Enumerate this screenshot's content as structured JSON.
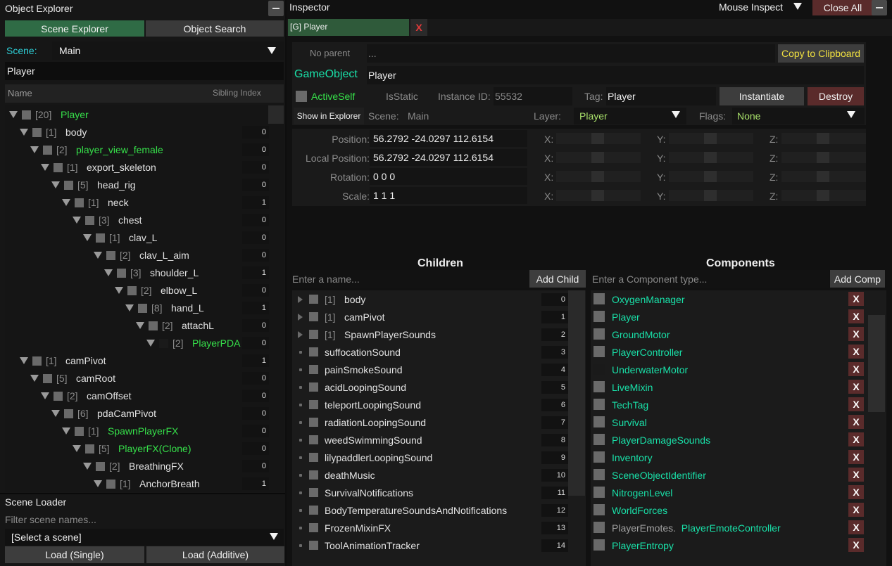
{
  "object_explorer": {
    "title": "Object Explorer",
    "tabs": [
      "Scene Explorer",
      "Object Search"
    ],
    "scene_label": "Scene:",
    "scene_value": "Main",
    "filter_value": "Player",
    "col_name": "Name",
    "col_sibling": "Sibling Index",
    "tree": [
      {
        "depth": 0,
        "count": "[20]",
        "name": "Player",
        "green": true,
        "idx": ""
      },
      {
        "depth": 1,
        "count": "[1]",
        "name": "body",
        "green": false,
        "idx": "0"
      },
      {
        "depth": 2,
        "count": "[2]",
        "name": "player_view_female",
        "green": true,
        "idx": "0"
      },
      {
        "depth": 3,
        "count": "[1]",
        "name": "export_skeleton",
        "green": false,
        "idx": "0"
      },
      {
        "depth": 4,
        "count": "[5]",
        "name": "head_rig",
        "green": false,
        "idx": "0"
      },
      {
        "depth": 5,
        "count": "[1]",
        "name": "neck",
        "green": false,
        "idx": "1"
      },
      {
        "depth": 6,
        "count": "[3]",
        "name": "chest",
        "green": false,
        "idx": "0"
      },
      {
        "depth": 7,
        "count": "[1]",
        "name": "clav_L",
        "green": false,
        "idx": "0"
      },
      {
        "depth": 8,
        "count": "[2]",
        "name": "clav_L_aim",
        "green": false,
        "idx": "0"
      },
      {
        "depth": 9,
        "count": "[3]",
        "name": "shoulder_L",
        "green": false,
        "idx": "1"
      },
      {
        "depth": 10,
        "count": "[2]",
        "name": "elbow_L",
        "green": false,
        "idx": "0"
      },
      {
        "depth": 11,
        "count": "[8]",
        "name": "hand_L",
        "green": false,
        "idx": "1"
      },
      {
        "depth": 12,
        "count": "[2]",
        "name": "attachL",
        "green": false,
        "idx": "0"
      },
      {
        "depth": 13,
        "count": "[2]",
        "name": "PlayerPDA",
        "green": true,
        "idx": "0",
        "off": true
      },
      {
        "depth": 1,
        "count": "[1]",
        "name": "camPivot",
        "green": false,
        "idx": "1"
      },
      {
        "depth": 2,
        "count": "[5]",
        "name": "camRoot",
        "green": false,
        "idx": "0"
      },
      {
        "depth": 3,
        "count": "[2]",
        "name": "camOffset",
        "green": false,
        "idx": "0"
      },
      {
        "depth": 4,
        "count": "[6]",
        "name": "pdaCamPivot",
        "green": false,
        "idx": "0"
      },
      {
        "depth": 5,
        "count": "[1]",
        "name": "SpawnPlayerFX",
        "green": true,
        "idx": "0"
      },
      {
        "depth": 6,
        "count": "[5]",
        "name": "PlayerFX(Clone)",
        "green": true,
        "idx": "0"
      },
      {
        "depth": 7,
        "count": "[2]",
        "name": "BreathingFX",
        "green": false,
        "idx": "0"
      },
      {
        "depth": 8,
        "count": "[1]",
        "name": "AnchorBreath",
        "green": false,
        "idx": "1"
      }
    ]
  },
  "scene_loader": {
    "title": "Scene Loader",
    "filter_placeholder": "Filter scene names...",
    "select_value": "[Select a scene]",
    "load_single": "Load (Single)",
    "load_additive": "Load (Additive)"
  },
  "inspector": {
    "title": "Inspector",
    "mouse_inspect": "Mouse Inspect",
    "close_all": "Close All",
    "tab_label": "[G] Player",
    "tab_close": "X",
    "no_parent": "No parent",
    "parent_value": "...",
    "copy_clipboard": "Copy to Clipboard",
    "gameobject_label": "GameObject",
    "name_value": "Player",
    "active_self": "ActiveSelf",
    "is_static": "IsStatic",
    "instance_id_label": "Instance ID:",
    "instance_id_value": "55532",
    "tag_label": "Tag:",
    "tag_value": "Player",
    "instantiate": "Instantiate",
    "destroy": "Destroy",
    "show_in_explorer": "Show in Explorer",
    "scene_label": "Scene:",
    "scene_value": "Main",
    "layer_label": "Layer:",
    "layer_value": "Player",
    "flags_label": "Flags:",
    "flags_value": "None",
    "transforms": [
      {
        "label": "Position:",
        "value": "56.2792 -24.0297 112.6154"
      },
      {
        "label": "Local Position:",
        "value": "56.2792 -24.0297 112.6154"
      },
      {
        "label": "Rotation:",
        "value": "0 0 0"
      },
      {
        "label": "Scale:",
        "value": "1 1 1"
      }
    ],
    "axis_labels": [
      "X:",
      "Y:",
      "Z:"
    ],
    "children_title": "Children",
    "children_placeholder": "Enter a name...",
    "add_child": "Add Child",
    "children": [
      {
        "name": "body",
        "count": "[1]",
        "idx": "0",
        "expand": true
      },
      {
        "name": "camPivot",
        "count": "[1]",
        "idx": "1",
        "expand": true
      },
      {
        "name": "SpawnPlayerSounds",
        "count": "[1]",
        "idx": "2",
        "expand": true
      },
      {
        "name": "suffocationSound",
        "count": "",
        "idx": "3",
        "expand": false
      },
      {
        "name": "painSmokeSound",
        "count": "",
        "idx": "4",
        "expand": false
      },
      {
        "name": "acidLoopingSound",
        "count": "",
        "idx": "5",
        "expand": false
      },
      {
        "name": "teleportLoopingSound",
        "count": "",
        "idx": "6",
        "expand": false
      },
      {
        "name": "radiationLoopingSound",
        "count": "",
        "idx": "7",
        "expand": false
      },
      {
        "name": "weedSwimmingSound",
        "count": "",
        "idx": "8",
        "expand": false
      },
      {
        "name": "lilypaddlerLoopingSound",
        "count": "",
        "idx": "9",
        "expand": false
      },
      {
        "name": "deathMusic",
        "count": "",
        "idx": "10",
        "expand": false
      },
      {
        "name": "SurvivalNotifications",
        "count": "",
        "idx": "11",
        "expand": false
      },
      {
        "name": "BodyTemperatureSoundsAndNotifications",
        "count": "",
        "idx": "12",
        "expand": false
      },
      {
        "name": "FrozenMixinFX",
        "count": "",
        "idx": "13",
        "expand": false
      },
      {
        "name": "ToolAnimationTracker",
        "count": "",
        "idx": "14",
        "expand": false
      }
    ],
    "components_title": "Components",
    "components_placeholder": "Enter a Component type...",
    "add_comp": "Add Comp",
    "components": [
      {
        "prefix": "",
        "name": "OxygenManager",
        "off": false
      },
      {
        "prefix": "",
        "name": "Player",
        "off": false
      },
      {
        "prefix": "",
        "name": "GroundMotor",
        "off": false
      },
      {
        "prefix": "",
        "name": "PlayerController",
        "off": false
      },
      {
        "prefix": "",
        "name": "UnderwaterMotor",
        "off": true
      },
      {
        "prefix": "",
        "name": "LiveMixin",
        "off": false
      },
      {
        "prefix": "",
        "name": "TechTag",
        "off": false
      },
      {
        "prefix": "",
        "name": "Survival",
        "off": false
      },
      {
        "prefix": "",
        "name": "PlayerDamageSounds",
        "off": false
      },
      {
        "prefix": "",
        "name": "Inventory",
        "off": false
      },
      {
        "prefix": "",
        "name": "SceneObjectIdentifier",
        "off": false
      },
      {
        "prefix": "",
        "name": "NitrogenLevel",
        "off": false
      },
      {
        "prefix": "",
        "name": "WorldForces",
        "off": false
      },
      {
        "prefix": "PlayerEmotes.",
        "name": "PlayerEmoteController",
        "off": false
      },
      {
        "prefix": "",
        "name": "PlayerEntropy",
        "off": false
      }
    ],
    "remove_label": "X"
  },
  "colors": {
    "green": "#36e04a",
    "teal": "#19e0a8",
    "yellow": "#f0e040",
    "destroy": "#5a2b2b"
  }
}
